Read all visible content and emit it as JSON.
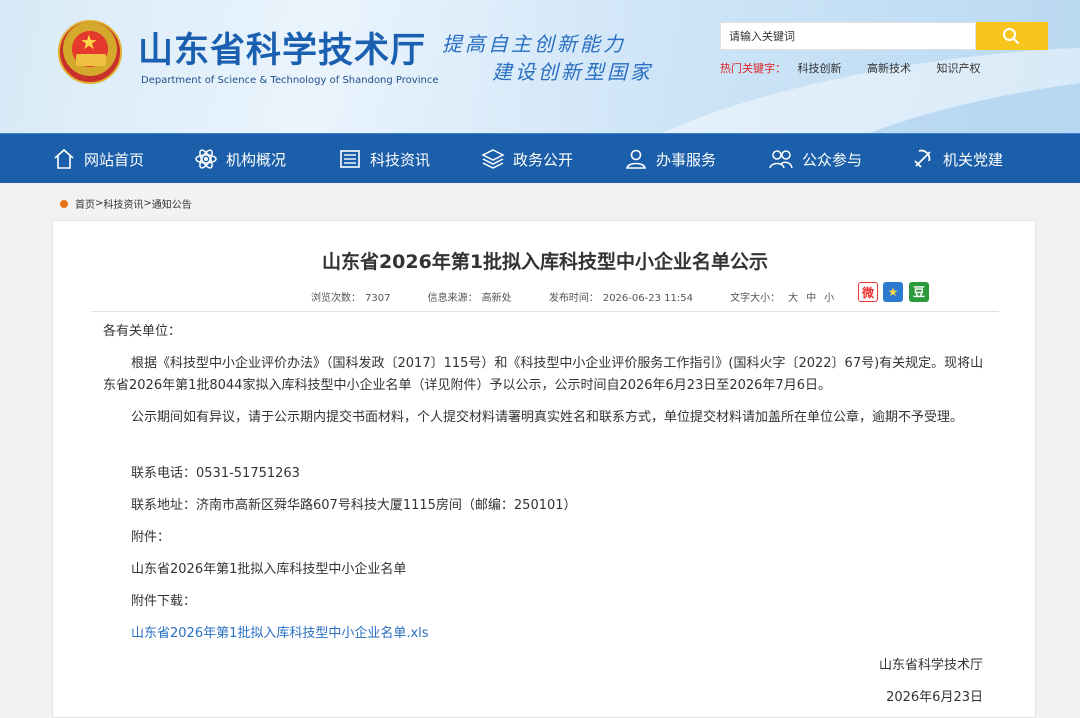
{
  "header": {
    "site_title": "山东省科学技术厅",
    "site_subtitle": "Department of Science & Technology of Shandong Province",
    "slogan_line1": "提高自主创新能力",
    "slogan_line2": "建设创新型国家",
    "search_placeholder": "请输入关键词",
    "hot_label": "热门关键字：",
    "hot_keywords": [
      "科技创新",
      "高新技术",
      "知识产权"
    ]
  },
  "nav": {
    "items": [
      {
        "label": "网站首页",
        "icon": "home-icon"
      },
      {
        "label": "机构概况",
        "icon": "atom-icon"
      },
      {
        "label": "科技资讯",
        "icon": "newspaper-icon"
      },
      {
        "label": "政务公开",
        "icon": "layers-icon"
      },
      {
        "label": "办事服务",
        "icon": "person-icon"
      },
      {
        "label": "公众参与",
        "icon": "people-icon"
      },
      {
        "label": "机关党建",
        "icon": "party-icon"
      }
    ]
  },
  "breadcrumb": {
    "items": [
      "首页",
      "科技资讯",
      "通知公告"
    ],
    "separator": ">"
  },
  "article": {
    "title": "山东省2026年第1批拟入库科技型中小企业名单公示",
    "meta": {
      "views_label": "浏览次数：",
      "views": "7307",
      "source_label": "信息来源：",
      "source": "高新处",
      "date_label": "发布时间：",
      "date": "2026-06-23 11:54",
      "fontsize_label": "文字大小：",
      "font_large": "大",
      "font_medium": "中",
      "font_small": "小"
    },
    "share": {
      "weibo": "微",
      "star": "★",
      "douban": "豆"
    },
    "greeting": "各有关单位：",
    "paragraph1": "根据《科技型中小企业评价办法》（国科发政〔2017〕115号）和《科技型中小企业评价服务工作指引》(国科火字〔2022〕67号)有关规定。现将山东省2026年第1批8044家拟入库科技型中小企业名单（详见附件）予以公示，公示时间自2026年6月23日至2026年7月6日。",
    "paragraph2": "公示期间如有异议，请于公示期内提交书面材料，个人提交材料请署明真实姓名和联系方式，单位提交材料请加盖所在单位公章，逾期不予受理。",
    "phone": "联系电话：0531-51751263",
    "address": "联系地址：济南市高新区舜华路607号科技大厦1115房间（邮编：250101）",
    "attachment_label": "附件：",
    "attachment_name": "山东省2026年第1批拟入库科技型中小企业名单",
    "download_label": "附件下载：",
    "download_link": "山东省2026年第1批拟入库科技型中小企业名单.xls",
    "signature": "山东省科学技术厅",
    "sign_date": "2026年6月23日"
  },
  "colors": {
    "nav_bg": "#1b5ea9",
    "title_blue": "#1a5fb0",
    "search_btn": "#f7c51c",
    "hot_red": "#dd2222",
    "link_blue": "#2a6fc2",
    "crumb_dot": "#e8741a"
  }
}
